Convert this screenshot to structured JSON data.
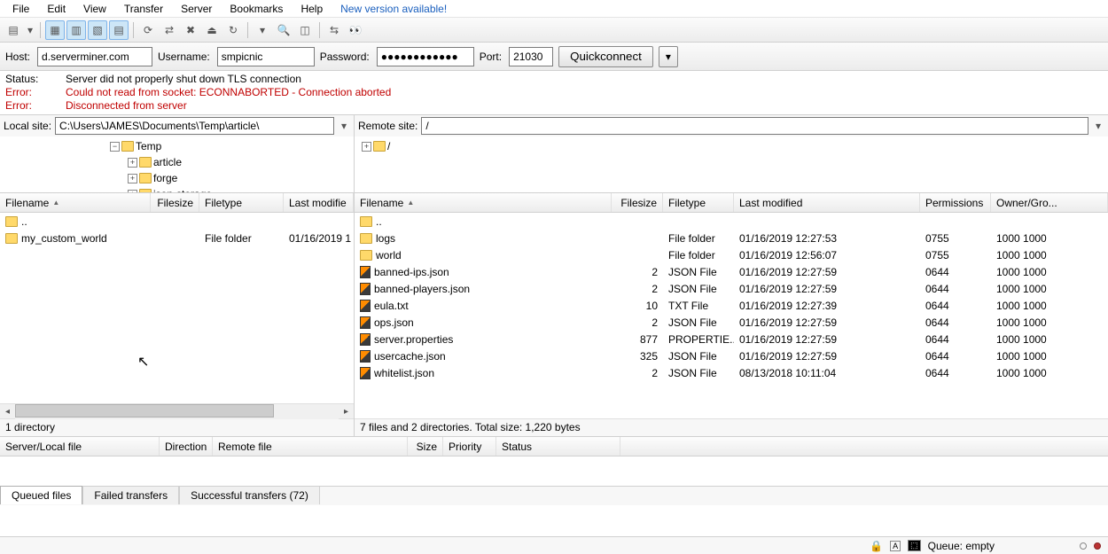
{
  "menu": {
    "items": [
      "File",
      "Edit",
      "View",
      "Transfer",
      "Server",
      "Bookmarks",
      "Help"
    ],
    "update": "New version available!"
  },
  "quickconnect": {
    "host_label": "Host:",
    "host": "d.serverminer.com",
    "user_label": "Username:",
    "user": "smpicnic",
    "pass_label": "Password:",
    "pass": "●●●●●●●●●●●●",
    "port_label": "Port:",
    "port": "21030",
    "button": "Quickconnect"
  },
  "log": [
    {
      "label": "Status:",
      "text": "Server did not properly shut down TLS connection",
      "err": false
    },
    {
      "label": "Error:",
      "text": "Could not read from socket: ECONNABORTED - Connection aborted",
      "err": true
    },
    {
      "label": "Error:",
      "text": "Disconnected from server",
      "err": true
    }
  ],
  "local": {
    "label": "Local site:",
    "path": "C:\\Users\\JAMES\\Documents\\Temp\\article\\",
    "tree": [
      {
        "indent": 120,
        "exp": "m",
        "name": "Temp"
      },
      {
        "indent": 140,
        "exp": "p",
        "name": "article"
      },
      {
        "indent": 140,
        "exp": "p",
        "name": "forge"
      },
      {
        "indent": 140,
        "exp": "p",
        "name": "json-storage"
      }
    ],
    "cols": {
      "name": "Filename",
      "size": "Filesize",
      "type": "Filetype",
      "mod": "Last modifie"
    },
    "rows": [
      {
        "icon": "folder",
        "name": "..",
        "size": "",
        "type": "",
        "mod": ""
      },
      {
        "icon": "folder",
        "name": "my_custom_world",
        "size": "",
        "type": "File folder",
        "mod": "01/16/2019 1"
      }
    ],
    "status": "1 directory"
  },
  "remote": {
    "label": "Remote site:",
    "path": "/",
    "tree": [
      {
        "indent": 4,
        "exp": "p",
        "name": "/"
      }
    ],
    "cols": {
      "name": "Filename",
      "size": "Filesize",
      "type": "Filetype",
      "mod": "Last modified",
      "perm": "Permissions",
      "own": "Owner/Gro..."
    },
    "rows": [
      {
        "icon": "folder",
        "name": "..",
        "size": "",
        "type": "",
        "mod": "",
        "perm": "",
        "own": ""
      },
      {
        "icon": "folder",
        "name": "logs",
        "size": "",
        "type": "File folder",
        "mod": "01/16/2019 12:27:53",
        "perm": "0755",
        "own": "1000 1000"
      },
      {
        "icon": "folder",
        "name": "world",
        "size": "",
        "type": "File folder",
        "mod": "01/16/2019 12:56:07",
        "perm": "0755",
        "own": "1000 1000"
      },
      {
        "icon": "s",
        "name": "banned-ips.json",
        "size": "2",
        "type": "JSON File",
        "mod": "01/16/2019 12:27:59",
        "perm": "0644",
        "own": "1000 1000"
      },
      {
        "icon": "s",
        "name": "banned-players.json",
        "size": "2",
        "type": "JSON File",
        "mod": "01/16/2019 12:27:59",
        "perm": "0644",
        "own": "1000 1000"
      },
      {
        "icon": "s",
        "name": "eula.txt",
        "size": "10",
        "type": "TXT File",
        "mod": "01/16/2019 12:27:39",
        "perm": "0644",
        "own": "1000 1000"
      },
      {
        "icon": "s",
        "name": "ops.json",
        "size": "2",
        "type": "JSON File",
        "mod": "01/16/2019 12:27:59",
        "perm": "0644",
        "own": "1000 1000"
      },
      {
        "icon": "s",
        "name": "server.properties",
        "size": "877",
        "type": "PROPERTIE...",
        "mod": "01/16/2019 12:27:59",
        "perm": "0644",
        "own": "1000 1000"
      },
      {
        "icon": "s",
        "name": "usercache.json",
        "size": "325",
        "type": "JSON File",
        "mod": "01/16/2019 12:27:59",
        "perm": "0644",
        "own": "1000 1000"
      },
      {
        "icon": "s",
        "name": "whitelist.json",
        "size": "2",
        "type": "JSON File",
        "mod": "08/13/2018 10:11:04",
        "perm": "0644",
        "own": "1000 1000"
      }
    ],
    "status": "7 files and 2 directories. Total size: 1,220 bytes"
  },
  "transfer_cols": {
    "file": "Server/Local file",
    "dir": "Direction",
    "remote": "Remote file",
    "size": "Size",
    "prio": "Priority",
    "status": "Status"
  },
  "tabs": {
    "queued": "Queued files",
    "failed": "Failed transfers",
    "success": "Successful transfers (72)"
  },
  "footer": {
    "queue": "Queue: empty"
  }
}
